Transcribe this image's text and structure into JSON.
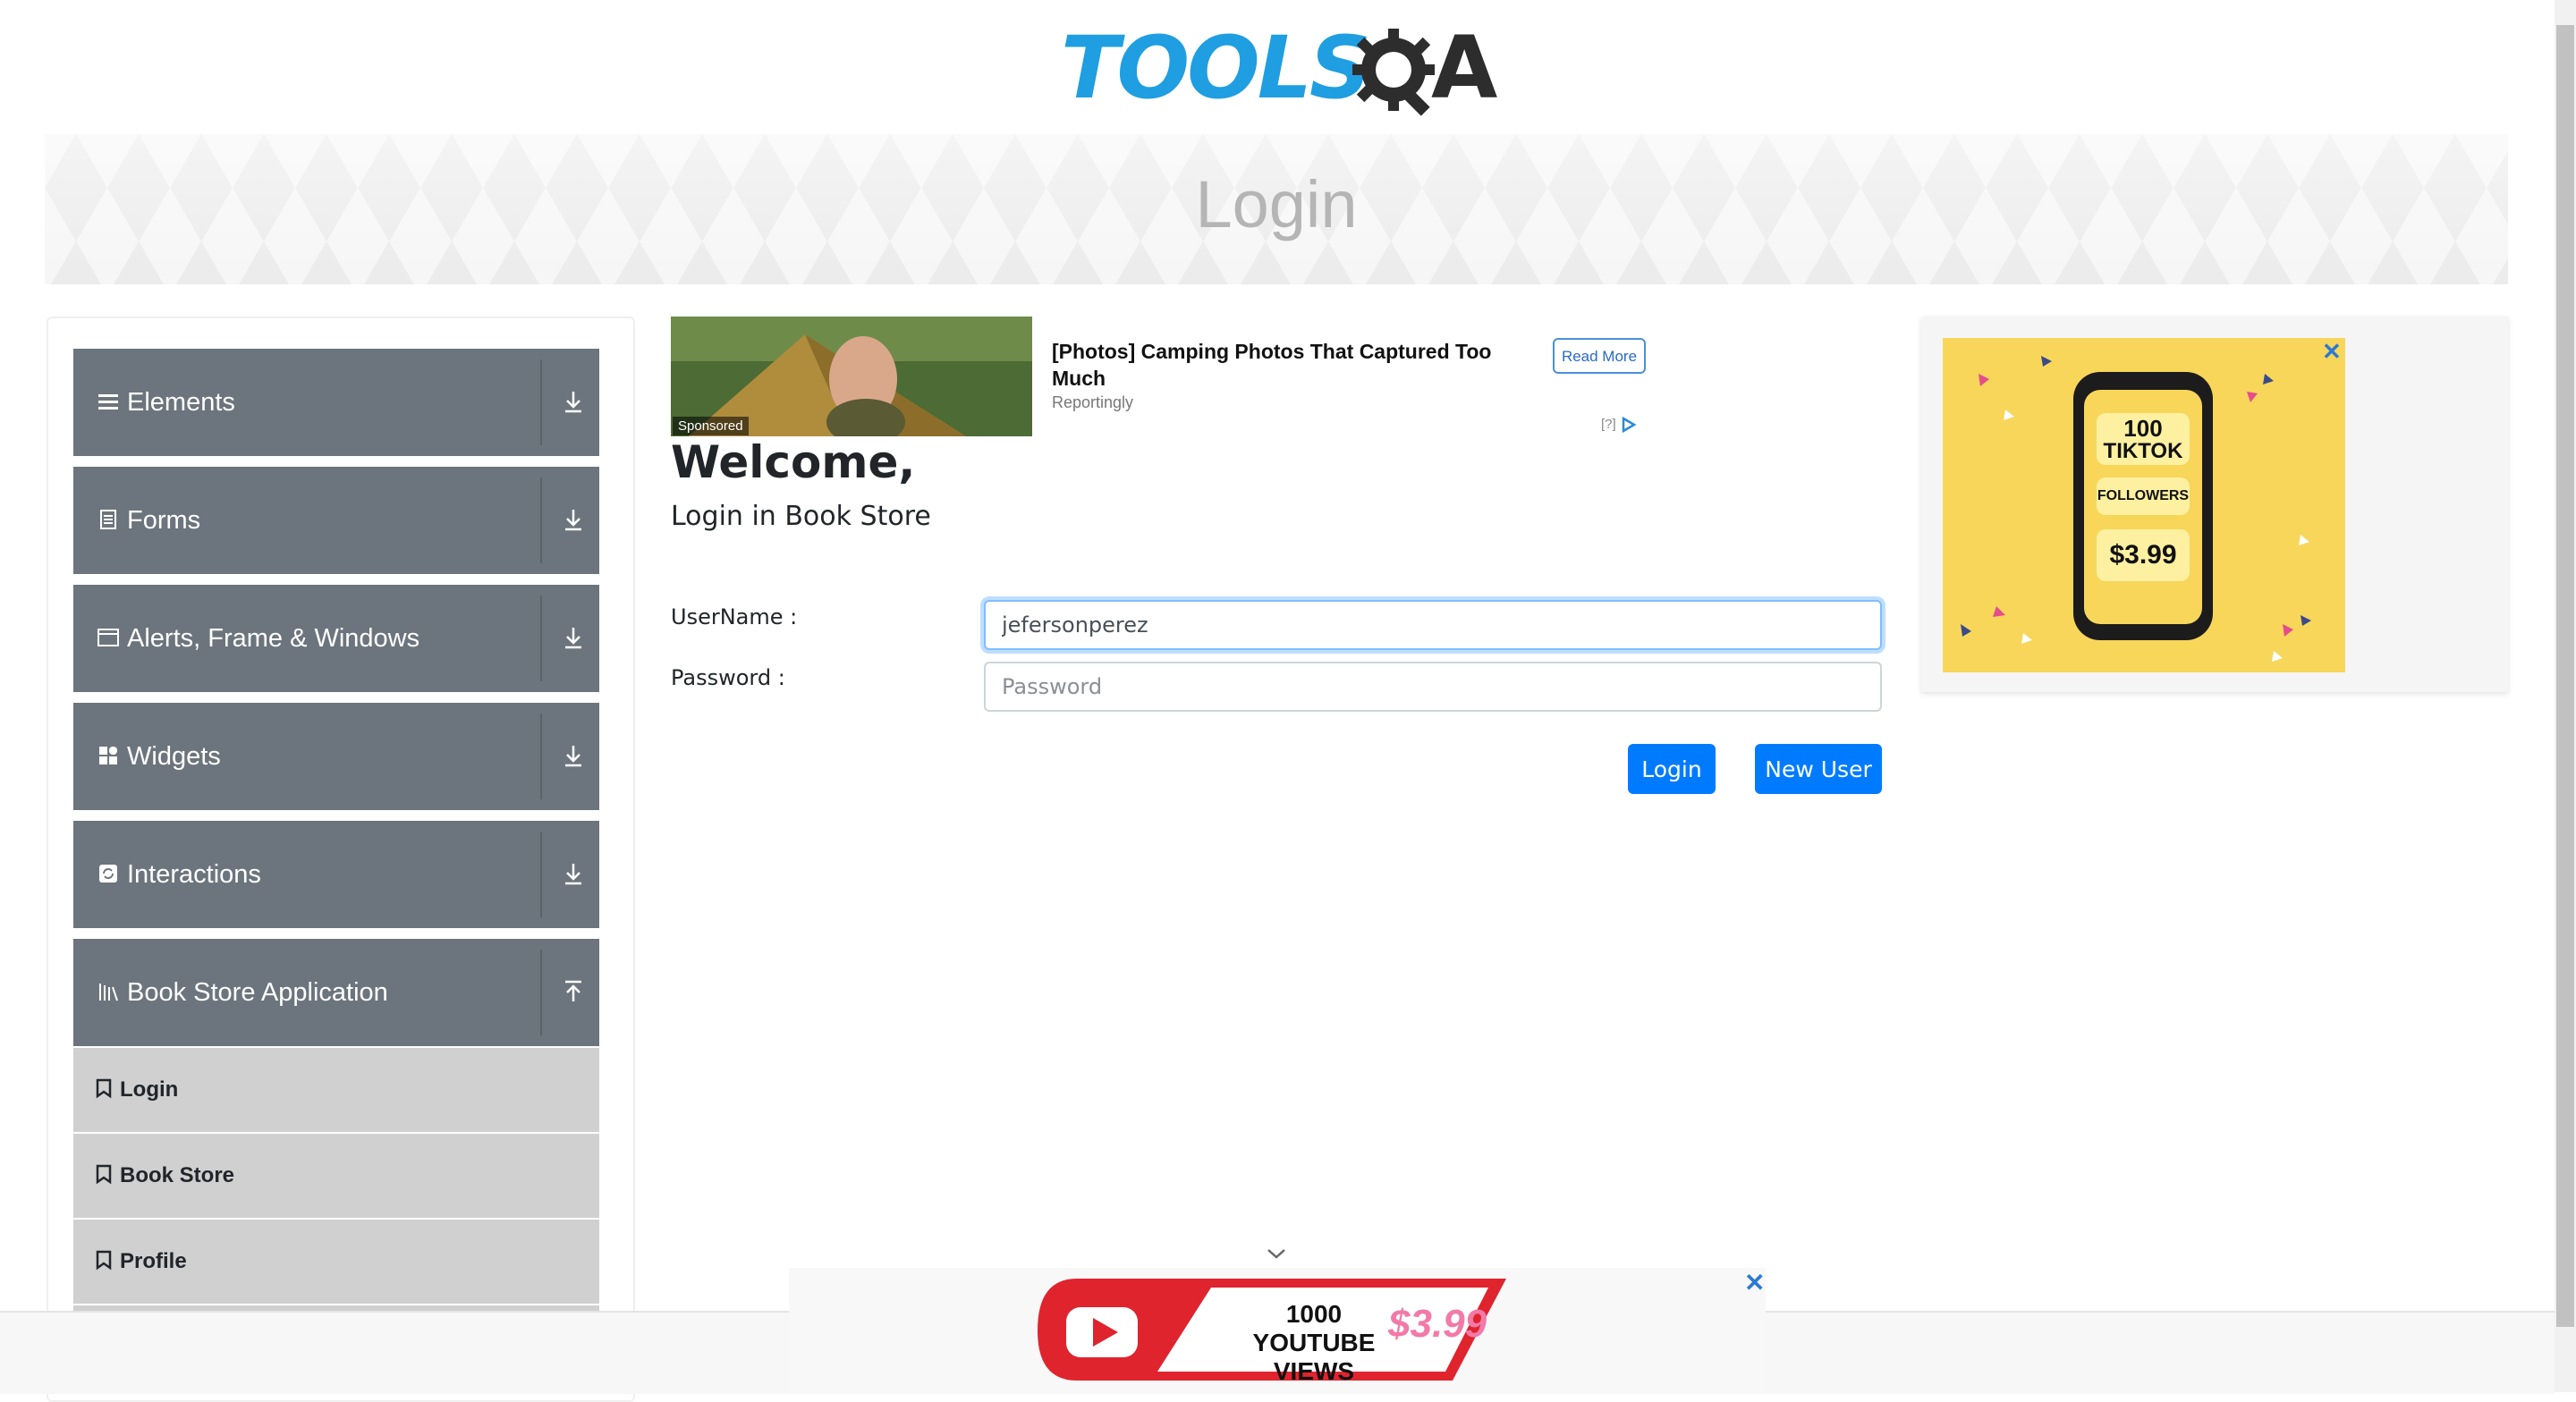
{
  "header": {
    "logo_text": "TOOLS",
    "logo_suffix": "A"
  },
  "banner": {
    "title": "Login"
  },
  "sidebar": {
    "groups": [
      {
        "label": "Elements",
        "icon": "hamburger-icon",
        "state": "collapsed"
      },
      {
        "label": "Forms",
        "icon": "document-icon",
        "state": "collapsed"
      },
      {
        "label": "Alerts, Frame & Windows",
        "icon": "window-icon",
        "state": "collapsed"
      },
      {
        "label": "Widgets",
        "icon": "grid-icon",
        "state": "collapsed"
      },
      {
        "label": "Interactions",
        "icon": "refresh-icon",
        "state": "collapsed"
      },
      {
        "label": "Book Store Application",
        "icon": "library-icon",
        "state": "expanded"
      }
    ],
    "book_store_items": [
      {
        "label": "Login"
      },
      {
        "label": "Book Store"
      },
      {
        "label": "Profile"
      }
    ]
  },
  "ad_top": {
    "sponsored": "Sponsored",
    "headline": "[Photos] Camping Photos That Captured Too Much",
    "source": "Reportingly",
    "cta": "Read More",
    "choice": "[?]"
  },
  "main": {
    "welcome": "Welcome,",
    "subtitle": "Login in Book Store",
    "username_label": "UserName :",
    "username_value": "jefersonperez",
    "password_label": "Password :",
    "password_placeholder": "Password",
    "login_button": "Login",
    "new_user_button": "New User"
  },
  "right_ad": {
    "line1": "100",
    "line2": "TIKTOK",
    "line3": "FOLLOWERS",
    "price": "$3.99",
    "close": "✕"
  },
  "bottom_ad": {
    "line1": "1000",
    "line2": "YOUTUBE VIEWS",
    "price": "$3.99",
    "close": "✕"
  },
  "colors": {
    "brand_blue": "#1f9ee1",
    "sidebar_group": "#6c757d",
    "sidebar_item": "#d0d0d0",
    "button_primary": "#007bff"
  }
}
